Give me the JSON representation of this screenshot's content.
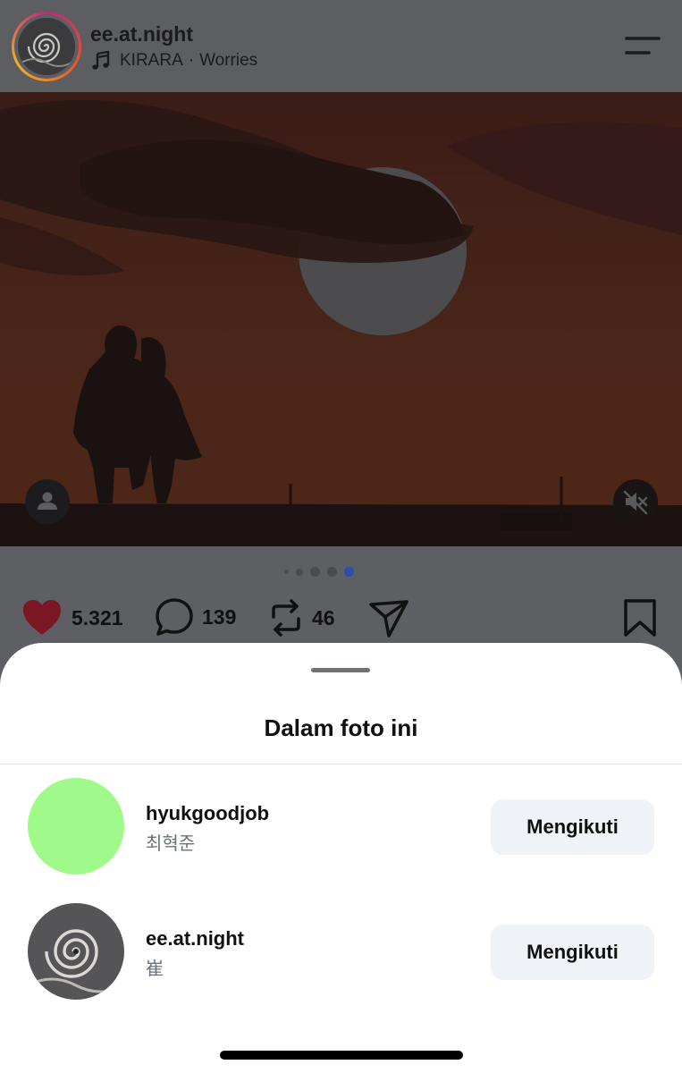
{
  "header": {
    "username": "ee.at.night",
    "music_artist": "KIRARA",
    "music_separator": "·",
    "music_track": "Worries"
  },
  "carousel": {
    "total": 5,
    "active_index": 4
  },
  "actions": {
    "likes": "5.321",
    "comments": "139",
    "reposts": "46",
    "like_color": "#c8263e"
  },
  "sheet": {
    "title": "Dalam foto ini",
    "people": [
      {
        "username": "hyukgoodjob",
        "name": "최혁준",
        "button": "Mengikuti",
        "avatar_color": "#9ffa8a"
      },
      {
        "username": "ee.at.night",
        "name": "崔",
        "button": "Mengikuti",
        "avatar_color": "#5a5a5a"
      }
    ]
  },
  "icons": {
    "menu": "hamburger-icon",
    "music": "music-note-icon",
    "tag": "person-icon",
    "mute": "speaker-muted-icon",
    "like": "heart-icon",
    "comment": "comment-bubble-icon",
    "repost": "repost-icon",
    "share": "paper-plane-icon",
    "save": "bookmark-icon"
  }
}
